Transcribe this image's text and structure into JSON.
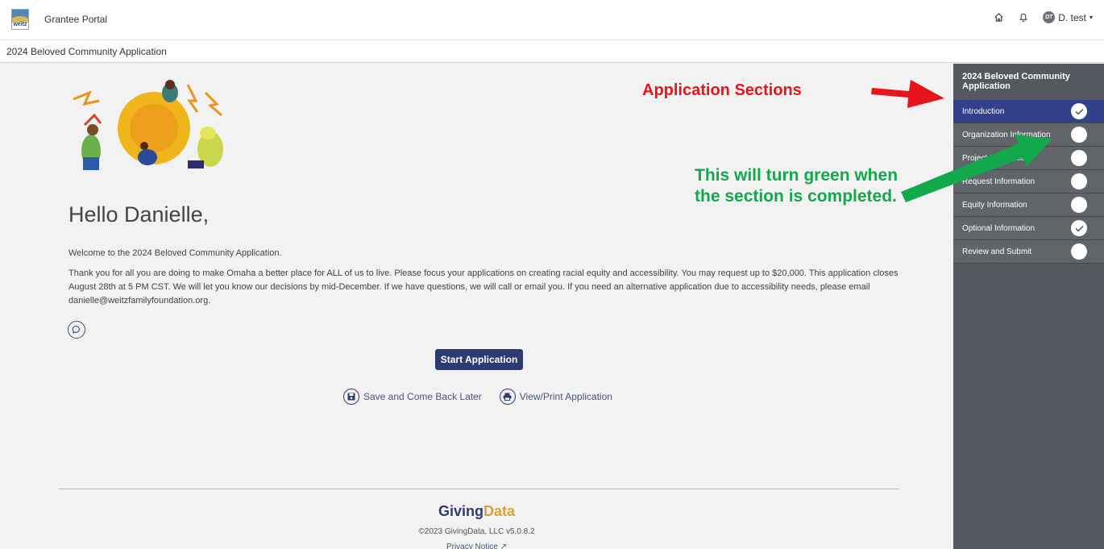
{
  "app": {
    "portal_title": "Grantee Portal",
    "logo_text": "weitz"
  },
  "header": {
    "user_initials": "DT",
    "user_name": "D. test",
    "caret": "▾"
  },
  "subbar": {
    "title": "2024 Beloved Community Application"
  },
  "main": {
    "greeting": "Hello Danielle,",
    "welcome": "Welcome to the 2024 Beloved Community Application.",
    "intro": "Thank you for all you are doing to make Omaha a better place for ALL of us to live. Please focus your applications on creating racial equity and accessibility. You may request up to $20,000. This application closes August 28th at 5 PM CST. We will let you know our decisions by mid-December.  If we have questions, we will call or email you. If you need an alternative application due to accessibility needs, please email danielle@weitzfamilyfoundation.org.",
    "start_button": "Start Application",
    "save_link": "Save and Come Back Later",
    "print_link": "View/Print Application"
  },
  "footer": {
    "brand_giving": "Giving",
    "brand_data": "Data",
    "copyright": "©2023 GivingData, LLC v5.0.8.2",
    "privacy": "Privacy Notice"
  },
  "annotations": {
    "sections": "Application Sections",
    "green_note": "This will turn green when the section is completed.",
    "red_color": "#e8141b",
    "green_color": "#11a94b"
  },
  "sidebar": {
    "title": "2024 Beloved Community Application",
    "items": [
      {
        "label": "Introduction",
        "status": "complete"
      },
      {
        "label": "Organization Information",
        "status": "incomplete"
      },
      {
        "label": "Project Information",
        "status": "incomplete"
      },
      {
        "label": "Request Information",
        "status": "incomplete"
      },
      {
        "label": "Equity Information",
        "status": "incomplete"
      },
      {
        "label": "Optional Information",
        "status": "complete"
      },
      {
        "label": "Review and Submit",
        "status": "incomplete"
      }
    ]
  },
  "icons": {
    "home": "home-icon",
    "bell": "bell-icon",
    "chat": "chat-bubble-icon",
    "save": "floppy-disk-icon",
    "print": "printer-icon",
    "check": "checkmark-icon"
  }
}
